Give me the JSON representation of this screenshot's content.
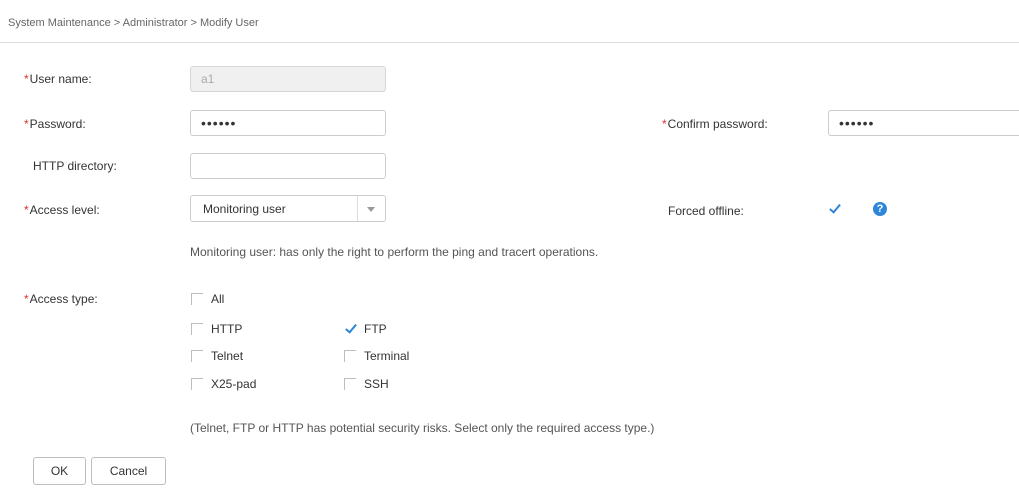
{
  "breadcrumb": "System Maintenance > Administrator > Modify User",
  "required_mark": "*",
  "form": {
    "username": {
      "label": "User name:",
      "value": "a1"
    },
    "password": {
      "label": "Password:",
      "value": "••••••"
    },
    "confirm_password": {
      "label": "Confirm password:",
      "value": "••••••"
    },
    "http_directory": {
      "label": "HTTP directory:",
      "value": ""
    },
    "access_level": {
      "label": "Access level:",
      "selected": "Monitoring user",
      "description": "Monitoring user: has only the right to perform the ping and tracert operations."
    },
    "forced_offline": {
      "label": "Forced offline:",
      "checked": true,
      "help_icon": "?"
    },
    "access_type": {
      "label": "Access type:",
      "all": {
        "label": "All",
        "checked": false
      },
      "http": {
        "label": "HTTP",
        "checked": false
      },
      "ftp": {
        "label": "FTP",
        "checked": true
      },
      "telnet": {
        "label": "Telnet",
        "checked": false
      },
      "terminal": {
        "label": "Terminal",
        "checked": false
      },
      "x25pad": {
        "label": "X25-pad",
        "checked": false
      },
      "ssh": {
        "label": "SSH",
        "checked": false
      },
      "note": "(Telnet, FTP or HTTP has potential security risks. Select only the required access type.)"
    }
  },
  "buttons": {
    "ok": "OK",
    "cancel": "Cancel"
  },
  "colors": {
    "required": "#e0312b",
    "accent": "#2d87d9"
  },
  "icons": {
    "help": "help-circle-icon",
    "check": "checkmark-icon",
    "dropdown": "chevron-down-icon"
  }
}
